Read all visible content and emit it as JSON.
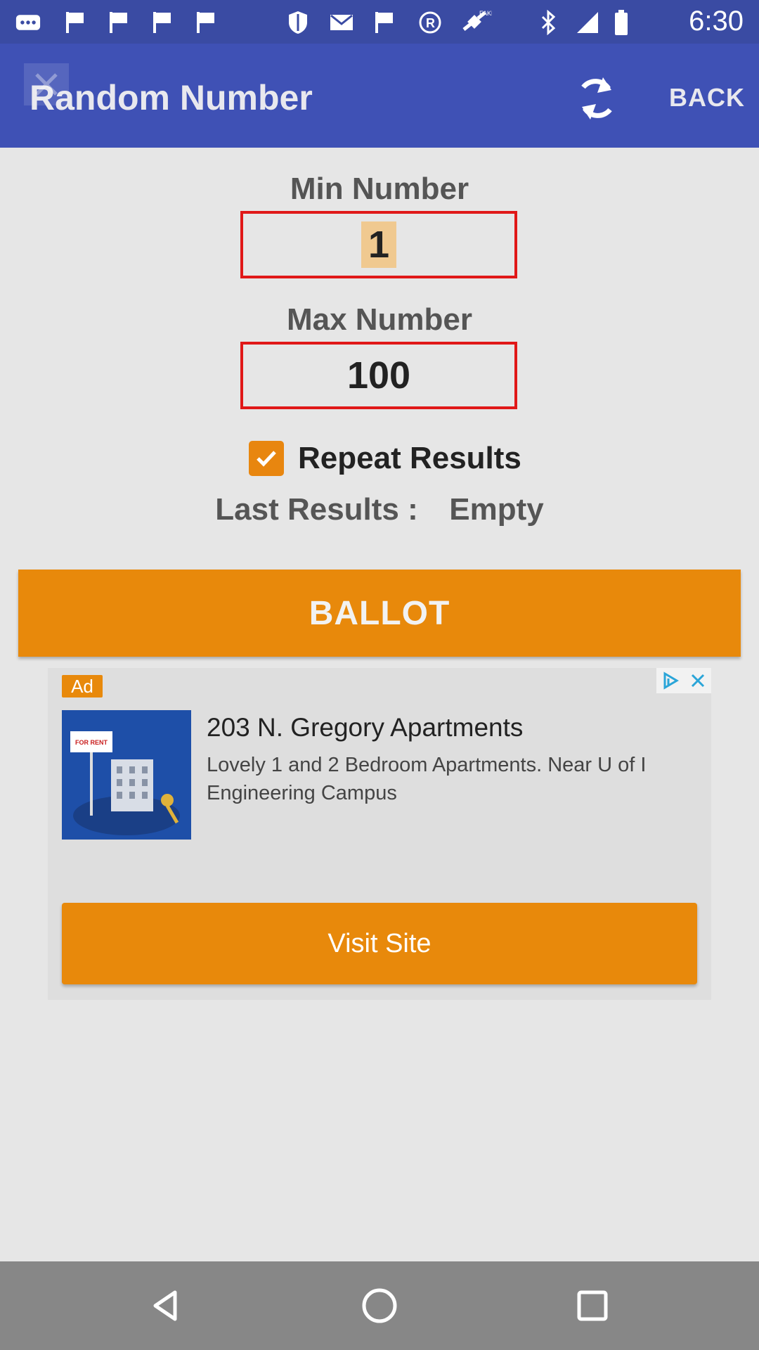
{
  "status_bar": {
    "time": "6:30",
    "icons": [
      "more-dots-icon",
      "flag-icon",
      "flag-icon",
      "flag-icon",
      "flag-icon",
      "shield-icon",
      "mail-icon",
      "flag-icon",
      "registered-icon",
      "fake-gps-icon",
      "bluetooth-icon",
      "signal-icon",
      "battery-icon"
    ]
  },
  "app_bar": {
    "title": "Random Number",
    "back_label": "BACK",
    "refresh_icon": "refresh-icon"
  },
  "form": {
    "min_label": "Min Number",
    "min_value": "1",
    "max_label": "Max Number",
    "max_value": "100",
    "repeat_label": "Repeat Results",
    "repeat_checked": true,
    "last_results_label": "Last Results :",
    "last_results_value": "Empty"
  },
  "ballot_label": "BALLOT",
  "ad": {
    "badge": "Ad",
    "title": "203 N. Gregory Apartments",
    "description": "Lovely 1 and 2 Bedroom Apartments. Near U of I Engineering Campus",
    "image_sign_text": "FOR RENT",
    "cta_label": "Visit Site"
  },
  "colors": {
    "status_bar": "#3a4ba3",
    "app_bar": "#3f51b5",
    "accent": "#e8890b",
    "field_border": "#e01818",
    "background": "#e6e6e6",
    "nav_bar": "#878787"
  },
  "nav_bar": {
    "buttons": [
      "back-triangle-icon",
      "home-circle-icon",
      "recents-square-icon"
    ]
  }
}
